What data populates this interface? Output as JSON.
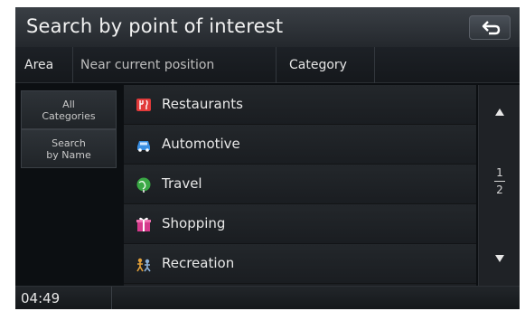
{
  "header": {
    "title": "Search by point of interest",
    "back_icon": "back-arrow-icon"
  },
  "tabs": {
    "area": "Area",
    "near": "Near current position",
    "category": "Category"
  },
  "side_menu": {
    "all_line1": "All",
    "all_line2": "Categories",
    "search_line1": "Search",
    "search_line2": "by Name"
  },
  "list": {
    "items": [
      {
        "label": "Restaurants",
        "icon": "restaurant-icon",
        "color": "#e23a3a"
      },
      {
        "label": "Automotive",
        "icon": "car-icon",
        "color": "#3a8fe2"
      },
      {
        "label": "Travel",
        "icon": "globe-icon",
        "color": "#3aa845"
      },
      {
        "label": "Shopping",
        "icon": "gift-icon",
        "color": "#d63a8c"
      },
      {
        "label": "Recreation",
        "icon": "recreation-icon",
        "color": "#e2a03a"
      }
    ]
  },
  "scroll": {
    "page_current": "1",
    "page_total": "2"
  },
  "status": {
    "time": "04:49"
  }
}
